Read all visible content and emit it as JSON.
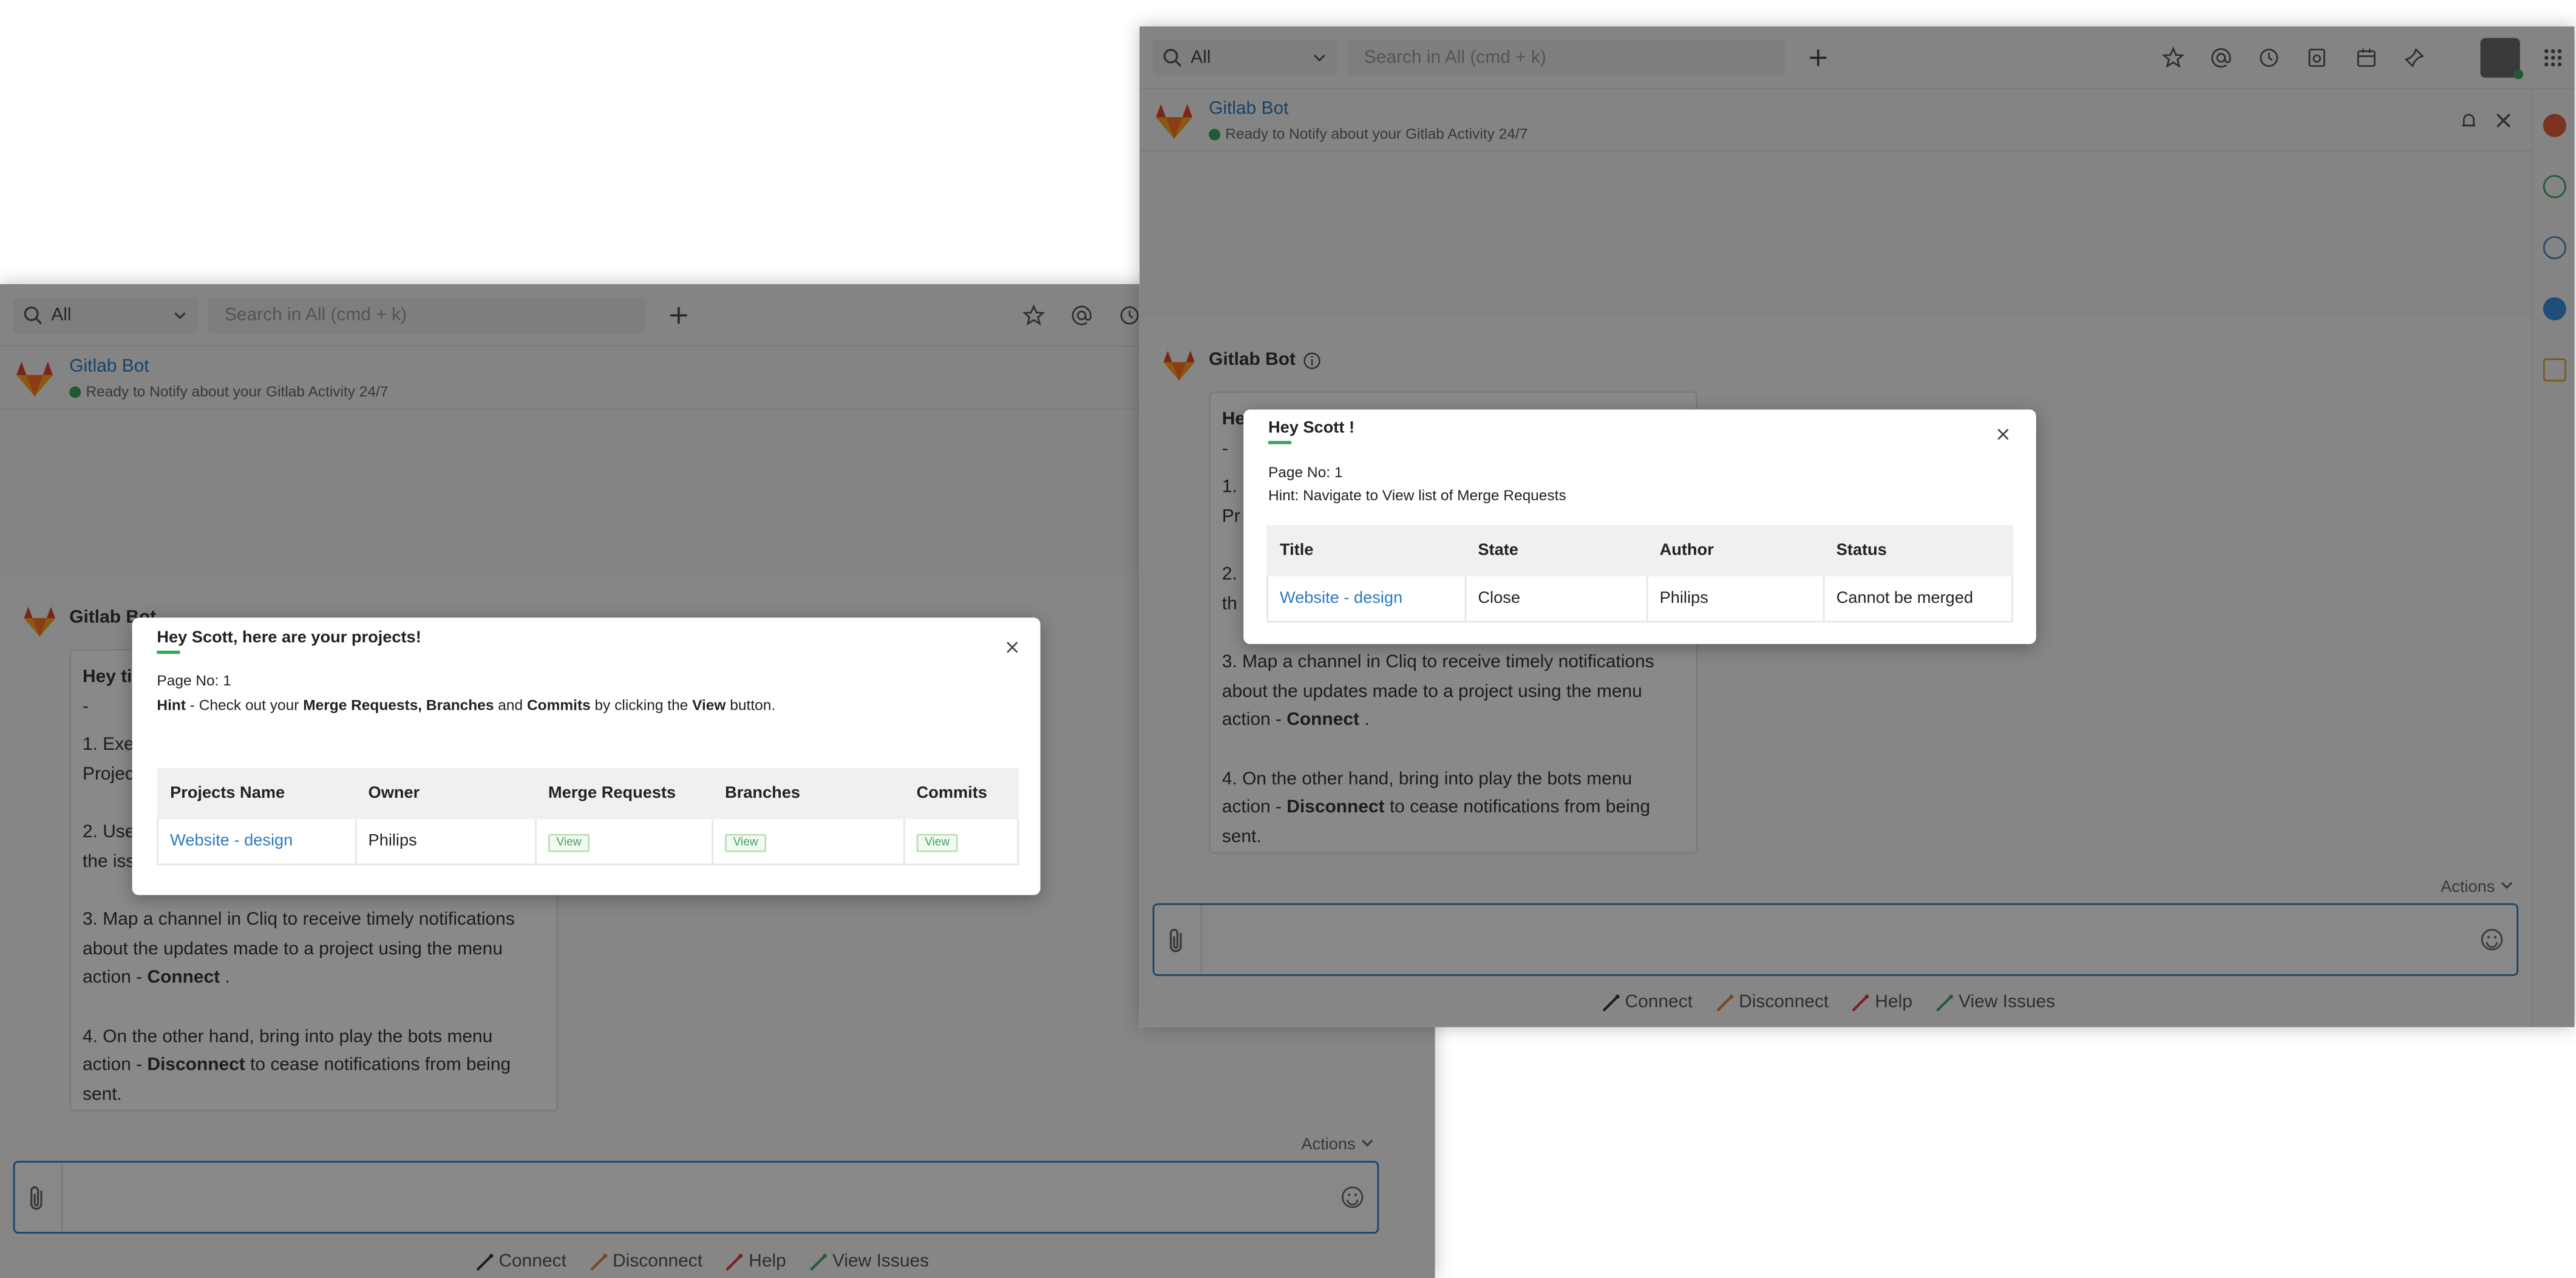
{
  "left_window": {
    "scope_label": "All",
    "search_placeholder": "Search in All (cmd + k)",
    "bot_name": "Gitlab Bot",
    "bot_status": "Ready to Notify about your Gitlab Activity 24/7",
    "msg_sender": "Gitlab Bot",
    "card": {
      "p3": "3. Map a channel in Cliq to receive timely notifications about the updates made to a project using the menu action - ",
      "p3_bold": "Connect",
      "p3_end": " .",
      "p4": "4. On the other hand, bring into play the bots menu action - ",
      "p4_bold": "Disconnect",
      "p4_end": " to cease notifications from being sent.",
      "frag1": "Hey ti",
      "frag2": "-",
      "frag3": "1. Exe",
      "frag4": "Projec",
      "frag5": "2. Use",
      "frag6": "the iss"
    },
    "actions_label": "Actions",
    "quick_actions": [
      "Connect",
      "Disconnect",
      "Help",
      "View Issues"
    ],
    "modal": {
      "title": "Hey Scott, here are your projects!",
      "page_no": "Page No: 1",
      "hint_prefix": "Hint",
      "hint_mid": " - Check out your ",
      "hint_b1": "Merge Requests, Branches",
      "hint_and": " and ",
      "hint_b2": "Commits",
      "hint_by": " by clicking the ",
      "hint_b3": "View",
      "hint_end": " button.",
      "headers": [
        "Projects Name",
        "Owner",
        "Merge Requests",
        "Branches",
        "Commits"
      ],
      "row": {
        "project": "Website - design",
        "owner": "Philips",
        "mr": "View",
        "br": "View",
        "cm": "View"
      }
    }
  },
  "right_window": {
    "scope_label": "All",
    "search_placeholder": "Search in All (cmd + k)",
    "bot_name": "Gitlab Bot",
    "bot_status": "Ready to Notify about your Gitlab Activity 24/7",
    "msg_sender": "Gitlab Bot",
    "card": {
      "p3": "3. Map a channel in Cliq to receive timely notifications about the updates made to a project using the menu action - ",
      "p3_bold": "Connect",
      "p3_end": " .",
      "p4": "4. On the other hand, bring into play the bots menu action - ",
      "p4_bold": "Disconnect",
      "p4_end": " to cease notifications from being sent.",
      "frag1": "He",
      "frag2": "-",
      "frag3": "1.",
      "frag4": "Pr",
      "frag5": "2.",
      "frag6": "th"
    },
    "actions_label": "Actions",
    "quick_actions": [
      "Connect",
      "Disconnect",
      "Help",
      "View Issues"
    ],
    "modal": {
      "title": "Hey Scott !",
      "page_no": "Page No: 1",
      "hint": "Hint: Navigate to View list of Merge Requests",
      "headers": [
        "Title",
        "State",
        "Author",
        "Status"
      ],
      "row": {
        "title": "Website - design",
        "state": "Close",
        "author": "Philips",
        "status": "Cannot be merged"
      }
    }
  },
  "colors": {
    "accent": "#2b7bbf",
    "green": "#3ca55c",
    "gitlab_orange": "#e24329"
  }
}
